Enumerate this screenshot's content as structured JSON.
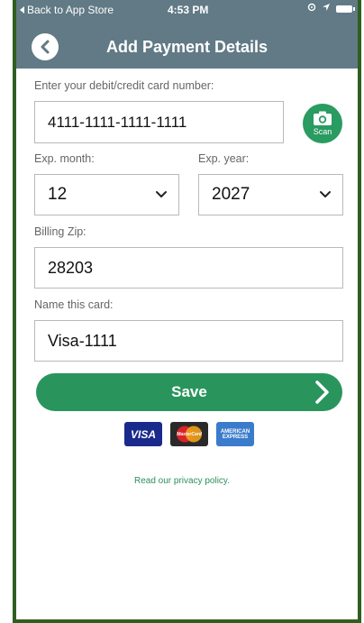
{
  "status_bar": {
    "back_text": "Back to App Store",
    "time": "4:53 PM"
  },
  "header": {
    "title": "Add Payment Details"
  },
  "form": {
    "card_number_label": "Enter your debit/credit card number:",
    "card_number_value": "4111-1111-1111-1111",
    "scan_label": "Scan",
    "exp_month_label": "Exp. month:",
    "exp_month_value": "12",
    "exp_year_label": "Exp. year:",
    "exp_year_value": "2027",
    "zip_label": "Billing Zip:",
    "zip_value": "28203",
    "card_name_label": "Name this card:",
    "card_name_value": "Visa-1111"
  },
  "save_button": {
    "label": "Save"
  },
  "card_logos": [
    "VISA",
    "MasterCard",
    "AMERICAN EXPRESS"
  ],
  "privacy_link": "Read our privacy policy.",
  "colors": {
    "header_bg": "#617a85",
    "accent_green": "#29955d",
    "frame_border": "#2f5f1f"
  }
}
